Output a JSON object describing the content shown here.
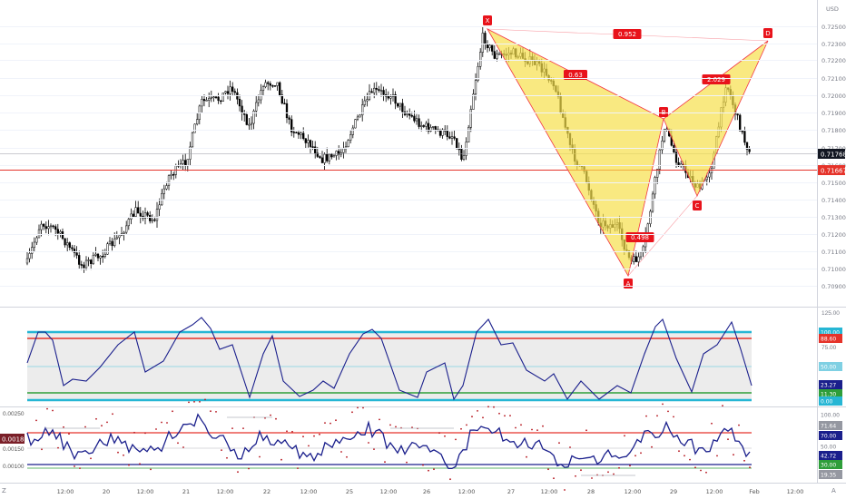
{
  "main": {
    "price_axis": {
      "unit": "USD",
      "ticks": [
        "0.72500",
        "0.72300",
        "0.72200",
        "0.72100",
        "0.72000",
        "0.71900",
        "0.71800",
        "0.71700",
        "0.71600",
        "0.71500",
        "0.71400",
        "0.71300",
        "0.71200",
        "0.71100",
        "0.71000",
        "0.70900"
      ]
    },
    "last_price_badge": "0.71768",
    "hline_badge": "0.71667",
    "pattern": {
      "points": [
        "X",
        "A",
        "B",
        "C",
        "D"
      ],
      "ratios": [
        "0.952",
        "0.63",
        "2.029",
        "0.498"
      ],
      "fill_color": "#f6e04b",
      "label_color": "#e8131b"
    }
  },
  "rsi_pane": {
    "ticks": [
      "125.00",
      "75.00"
    ],
    "badges": [
      "100.00",
      "88.60",
      "50.00",
      "23.27",
      "11.30",
      "0.00"
    ]
  },
  "osc_pane": {
    "ticks": [
      "0.00250",
      "0.00150",
      "0.00100"
    ],
    "badges": [
      "100.00",
      "71.64",
      "70.00",
      "50.00",
      "42.72",
      "30.00",
      "19.35"
    ],
    "left_badge": "0.00180"
  },
  "time_axis": {
    "labels": [
      "12:00",
      "20",
      "12:00",
      "21",
      "12:00",
      "22",
      "12:00",
      "25",
      "12:00",
      "26",
      "12:00",
      "27",
      "12:00",
      "28",
      "12:00",
      "29",
      "12:00",
      "Feb",
      "12:00"
    ],
    "corner_left": "Z",
    "corner_right": "A"
  },
  "colors": {
    "candle": "#000000",
    "pattern_line": "#f23645",
    "hline": "#e5332a",
    "osc_line": "#1a1f8c",
    "band_cyan": "#26b6d4",
    "band_green": "#2e9e3a",
    "band_red": "#e5332a"
  }
}
